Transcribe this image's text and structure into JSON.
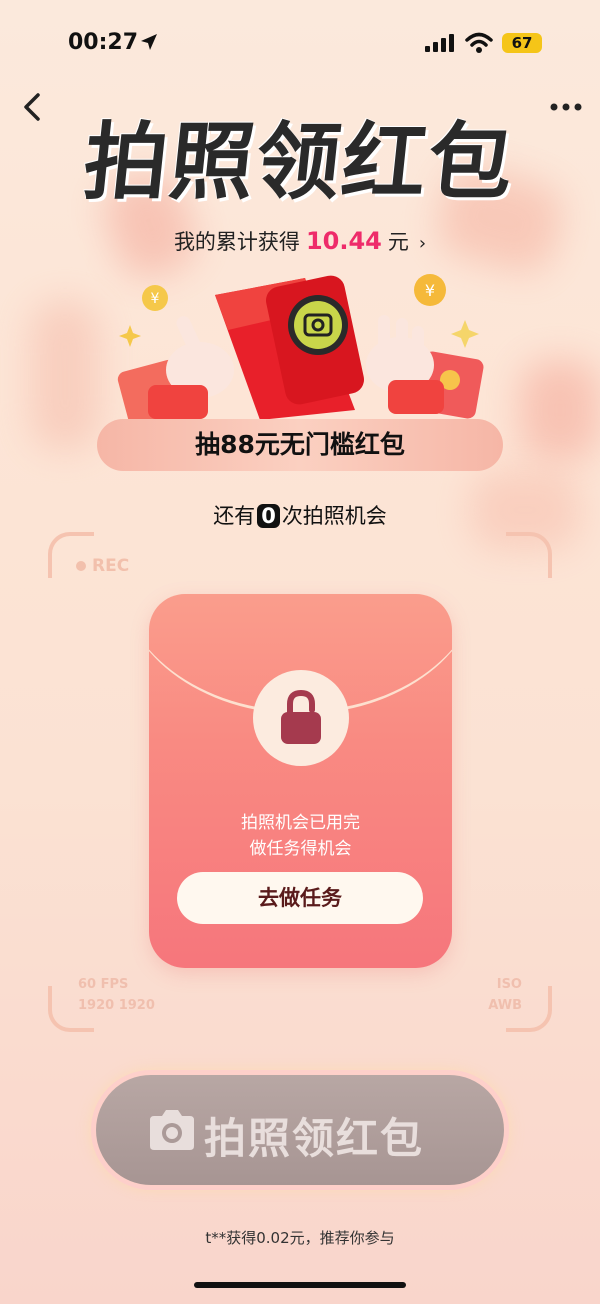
{
  "status": {
    "time": "00:27",
    "battery": "67"
  },
  "header": {
    "title": "拍照领红包"
  },
  "earnings": {
    "prefix": "我的累计获得",
    "amount": "10.44",
    "unit": "元",
    "arrow": "›"
  },
  "banner": {
    "text": "抽88元无门槛红包"
  },
  "chances": {
    "prefix": "还有",
    "count": "0",
    "suffix": "次拍照机会"
  },
  "viewfinder": {
    "rec": "REC",
    "fps": "60 FPS",
    "res": "1920  1920",
    "iso": "ISO",
    "awb": "AWB"
  },
  "envelope": {
    "line1": "拍照机会已用完",
    "line2": "做任务得机会",
    "button": "去做任务"
  },
  "shoot": {
    "label": "拍照领红包"
  },
  "ticker": {
    "text": "t**获得0.02元，推荐你参与"
  },
  "colors": {
    "accent": "#ee2b6a",
    "envelope": "#f98a82",
    "battery": "#f5c518"
  }
}
